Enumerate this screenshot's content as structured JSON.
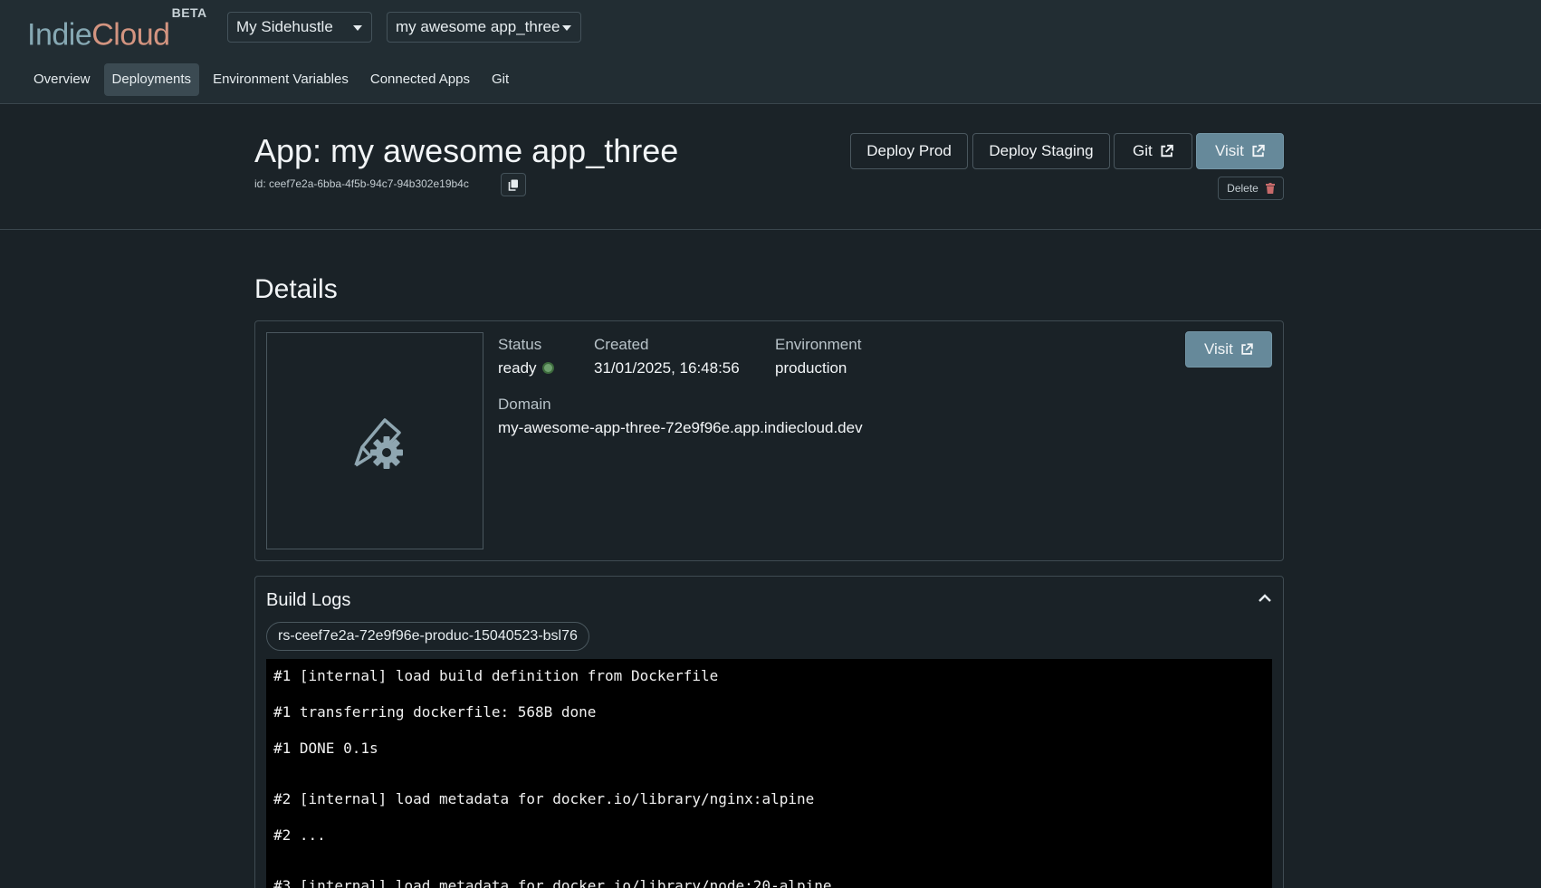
{
  "brand": {
    "part1": "Indie",
    "part2": "Cloud",
    "badge": "BETA"
  },
  "selectors": {
    "org": "My Sidehustle",
    "app": "my awesome app_three"
  },
  "tabs": [
    {
      "label": "Overview"
    },
    {
      "label": "Deployments"
    },
    {
      "label": "Environment Variables"
    },
    {
      "label": "Connected Apps"
    },
    {
      "label": "Git"
    }
  ],
  "active_tab": "Deployments",
  "header": {
    "title": "App: my awesome app_three",
    "id_text": "id: ceef7e2a-6bba-4f5b-94c7-94b302e19b4c",
    "deploy_prod": "Deploy Prod",
    "deploy_staging": "Deploy Staging",
    "git": "Git",
    "visit": "Visit",
    "delete": "Delete"
  },
  "details": {
    "title": "Details",
    "status_label": "Status",
    "status_value": "ready",
    "created_label": "Created",
    "created_value": "31/01/2025, 16:48:56",
    "environment_label": "Environment",
    "environment_value": "production",
    "domain_label": "Domain",
    "domain_value": "my-awesome-app-three-72e9f96e.app.indiecloud.dev",
    "visit": "Visit"
  },
  "build_logs": {
    "title": "Build Logs",
    "pod": "rs-ceef7e2a-72e9f96e-produc-15040523-bsl76",
    "lines": [
      "#1 [internal] load build definition from Dockerfile",
      "#1 transferring dockerfile: 568B done",
      "#1 DONE 0.1s",
      "#2 [internal] load metadata for docker.io/library/nginx:alpine",
      "#2 ...",
      "#3 [internal] load metadata for docker.io/library/node:20-alpine"
    ]
  },
  "colors": {
    "topbar": "#222d33",
    "background": "#1a2227",
    "primary_button": "#66899a",
    "status_ready": "#6ea06e",
    "brand_indie": "#86a8b3",
    "brand_cloud": "#d39480"
  }
}
